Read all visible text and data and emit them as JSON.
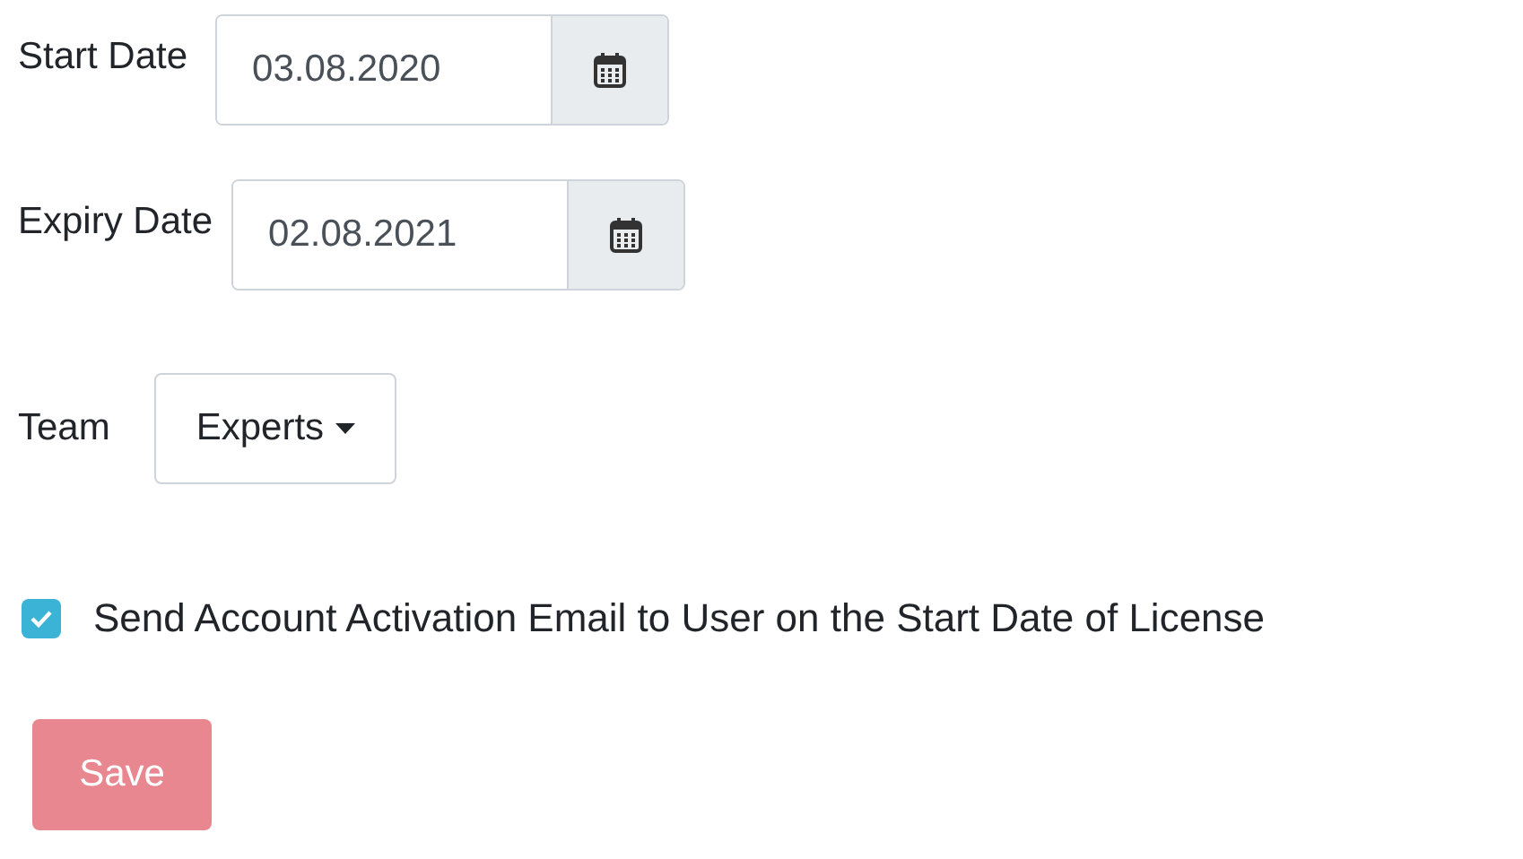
{
  "date_fields": [
    {
      "label": "Start Date",
      "value": "03.08.2020"
    },
    {
      "label": "Expiry Date",
      "value": "02.08.2021"
    }
  ],
  "team": {
    "label": "Team",
    "value": "Experts"
  },
  "activation_email": {
    "label": "Send Account Activation Email to User on the Start Date of License",
    "checked": true
  },
  "save_button": {
    "label": "Save",
    "disabled": true
  }
}
